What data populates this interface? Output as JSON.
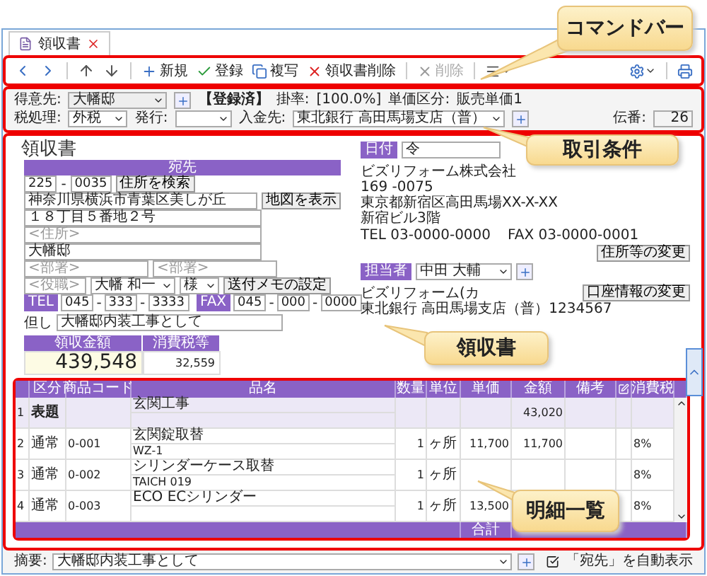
{
  "tab": {
    "label": "領収書",
    "selected": true
  },
  "command_bar": {
    "buttons": [
      {
        "kind": "new",
        "label": "新規",
        "disabled": false
      },
      {
        "kind": "save",
        "label": "登録",
        "disabled": false
      },
      {
        "kind": "copy",
        "label": "複写",
        "disabled": false
      },
      {
        "kind": "delete_doc",
        "label": "領収書削除",
        "disabled": false
      },
      {
        "kind": "delete",
        "label": "削除",
        "disabled": true
      }
    ]
  },
  "conditions": {
    "customer": {
      "label": "得意先:",
      "value": "大幡邸"
    },
    "status": "【登録済】",
    "rate_label": "掛率:",
    "rate": "[100.0%]",
    "price_class_label": "単価区分:",
    "price_class": "販売単価1",
    "tax": {
      "label": "税処理:",
      "value": "外税"
    },
    "issue": {
      "label": "発行:"
    },
    "deposit": {
      "label": "入金先:",
      "value": "東北銀行 高田馬場支店（普）"
    },
    "slip": {
      "label": "伝番:",
      "value": "26"
    }
  },
  "receipt": {
    "title": "領収書",
    "recipient": {
      "header": "宛先",
      "zip": [
        {
          "kind": "field",
          "text": "225"
        },
        {
          "kind": "sep",
          "text": "-"
        },
        {
          "kind": "field",
          "text": "0035"
        }
      ],
      "search_button": "住所を検索",
      "address1": "神奈川県横浜市青葉区美しが丘",
      "map_button": "地図を表示",
      "address2": "１８丁目５番地２号",
      "address3_placeholder": "<住所>",
      "name": "大幡邸",
      "dept1_placeholder": "<部署>",
      "dept2_placeholder": "<部署>",
      "role_placeholder": "<役職>",
      "person": "大幡 和一",
      "honorific": "様",
      "memo_button": "送付メモの設定",
      "tel": {
        "label": "TEL",
        "parts": [
          {
            "kind": "field",
            "text": "045"
          },
          {
            "kind": "sep",
            "text": "-"
          },
          {
            "kind": "field",
            "text": "333"
          },
          {
            "kind": "sep",
            "text": "-"
          },
          {
            "kind": "field",
            "text": "3333"
          }
        ]
      },
      "fax": {
        "label": "FAX",
        "parts": [
          {
            "kind": "field",
            "text": "045"
          },
          {
            "kind": "sep",
            "text": "-"
          },
          {
            "kind": "field",
            "text": "000"
          },
          {
            "kind": "sep",
            "text": "-"
          },
          {
            "kind": "field",
            "text": "0000"
          }
        ]
      },
      "note": {
        "label": "但し",
        "value": "大幡邸内装工事として"
      },
      "amount": {
        "label": "領収金額",
        "value": "439,548"
      },
      "tax_amount": {
        "label": "消費税等",
        "value": "32,559"
      }
    },
    "issuer": {
      "date_label": "日付",
      "date_value": "令",
      "company": "ビズリフォーム株式会社",
      "zip": "169 -0075",
      "address": "東京都新宿区高田馬場XX-X-XX",
      "building": "新宿ビル3階",
      "tel": "TEL 03-0000-0000",
      "fax": "FAX 03-0000-0001",
      "address_button": "住所等の変更",
      "staff": {
        "label": "担当者",
        "value": "中田 大輔"
      },
      "account_name": "ビズリフォーム(カ",
      "account_button": "口座情報の変更",
      "bank": "東北銀行 高田馬場支店（普）1234567"
    }
  },
  "table": {
    "columns": [
      {
        "kind": "text",
        "label": "区分"
      },
      {
        "kind": "text",
        "label": "商品コード"
      },
      {
        "kind": "text",
        "label": "品名"
      },
      {
        "kind": "text",
        "label": "数量"
      },
      {
        "kind": "text",
        "label": "単位"
      },
      {
        "kind": "text",
        "label": "単価"
      },
      {
        "kind": "text",
        "label": "金額"
      },
      {
        "kind": "text",
        "label": "備考"
      },
      {
        "kind": "icon"
      },
      {
        "kind": "text",
        "label": "消費税"
      }
    ],
    "rows": [
      {
        "no": "1",
        "type": "表題",
        "name": "玄関工事",
        "amount": "43,020",
        "heading": true
      },
      {
        "no": "2",
        "type": "通常",
        "code": "0-001",
        "name": "玄関錠取替",
        "spec": "WZ-1",
        "qty": "1",
        "unit": "ヶ所",
        "price": "11,700",
        "amount": "11,700",
        "tax": "8%",
        "heading": false
      },
      {
        "no": "3",
        "type": "通常",
        "code": "0-002",
        "name": "シリンダーケース取替",
        "spec": "TAICH 019",
        "qty": "1",
        "unit": "ヶ所",
        "tax": "8%",
        "heading": false
      },
      {
        "no": "4",
        "type": "通常",
        "code": "0-003",
        "name": "ECO ECシリンダー",
        "qty": "1",
        "unit": "ヶ所",
        "price": "13,500",
        "tax": "8%",
        "heading": false
      }
    ],
    "footer": {
      "label": "合計"
    }
  },
  "bottom": {
    "summary": {
      "label": "摘要:",
      "value": "大幡邸内装工事として"
    },
    "auto_show": {
      "label": "「宛先」を自動表示",
      "checked": true
    }
  },
  "callouts": [
    {
      "text": "コマンドバー"
    },
    {
      "text": "取引条件"
    },
    {
      "text": "領収書"
    },
    {
      "text": "明細一覧"
    }
  ]
}
